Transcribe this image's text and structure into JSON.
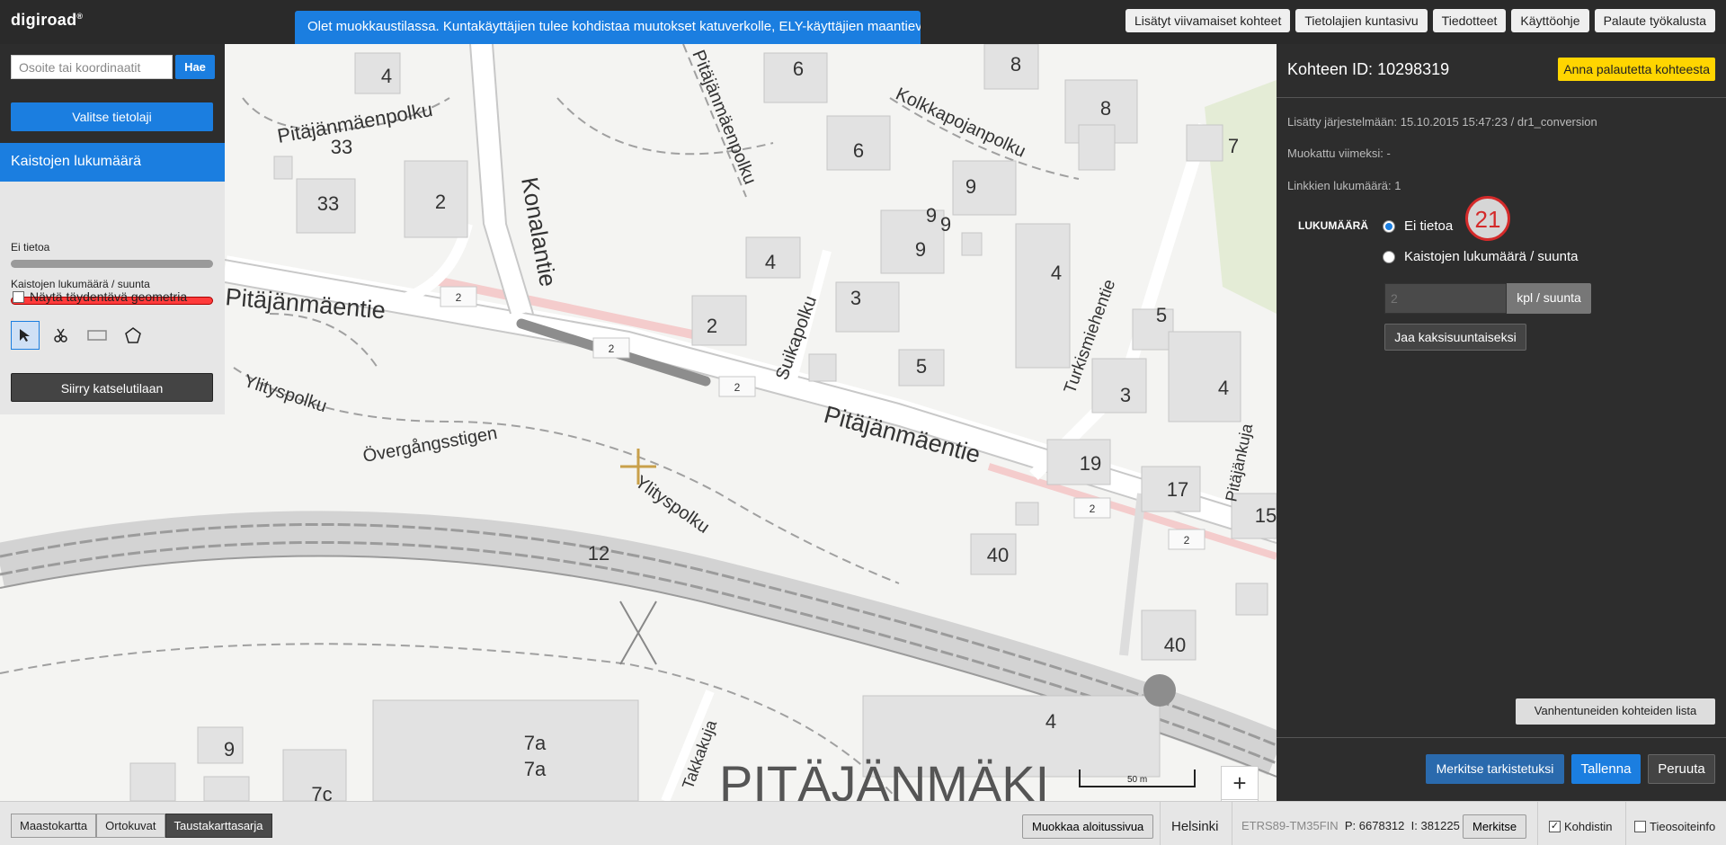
{
  "header": {
    "logo": "digiroad",
    "logo_mark": "®",
    "banner": "Olet muokkaustilassa. Kuntakäyttäjien tulee kohdistaa muutokset katuverkolle, ELY-käyttäjien maantieverkolle.",
    "links": [
      "Lisätyt viivamaiset kohteet",
      "Tietolajien kuntasivu",
      "Tiedotteet",
      "Käyttöohje",
      "Palaute työkalusta"
    ]
  },
  "left_panel": {
    "search_placeholder": "Osoite tai koordinaatit",
    "search_button": "Hae",
    "select_layer_button": "Valitse tietolaji",
    "layer_title": "Kaistojen lukumäärä",
    "legend": [
      {
        "label": "Ei tietoa",
        "color": "#9a9a9a"
      },
      {
        "label": "Kaistojen lukumäärä / suunta",
        "color": "#ff3b3b"
      }
    ],
    "complementary_geometry_label": "Näytä täydentävä geometria",
    "tools": [
      "select-arrow-icon",
      "scissors-icon",
      "rectangle-icon",
      "polygon-icon"
    ],
    "view_mode_button": "Siirry katselutilaan"
  },
  "right_panel": {
    "title": "Kohteen ID: 10298319",
    "feedback_button": "Anna palautetta kohteesta",
    "added": "Lisätty järjestelmään: 15.10.2015 15:47:23 / dr1_conversion",
    "modified": "Muokattu viimeksi: -",
    "link_count": "Linkkien lukumäärä: 1",
    "field_label": "LUKUMÄÄRÄ",
    "options": [
      "Ei tietoa",
      "Kaistojen lukumäärä / suunta"
    ],
    "selected_option": "Ei tietoa",
    "badge": "21",
    "count_placeholder": "2",
    "unit_label": "kpl / suunta",
    "split_button": "Jaa kaksisuuntaiseksi",
    "expired_button": "Vanhentuneiden kohteiden lista",
    "mark_checked_button": "Merkitse tarkistetuksi",
    "save_button": "Tallenna",
    "cancel_button": "Peruuta"
  },
  "map": {
    "zoom_in": "+",
    "zoom_out": "−",
    "scale_label": "50 m",
    "labels": {
      "pitajanmaenpolku": "Pitäjänmäenpolku",
      "pitajanmaentie": "Pitäjänmäentie",
      "konalantie": "Konalantie",
      "kolkkapojanpolku": "Kolkkapojanpolku",
      "suikapolku": "Suikapolku",
      "turkismiehentie": "Turkismiehentie",
      "ylityspolku": "Ylityspolku",
      "overgangsstigen": "Övergångsstigen",
      "pitajankuja": "Pitäjänkuja",
      "takkakuja": "Takkakuja",
      "district": "PITÄJÄNMÄKI"
    },
    "numbers": [
      "4",
      "33",
      "33",
      "2",
      "6",
      "8",
      "8",
      "6",
      "7",
      "9",
      "9",
      "9",
      "9",
      "4",
      "4",
      "3",
      "2",
      "5",
      "5",
      "3",
      "4",
      "19",
      "17",
      "15",
      "40",
      "40",
      "12",
      "4",
      "9",
      "7a",
      "7a",
      "7c"
    ],
    "road_number": "2"
  },
  "bottom_bar": {
    "basemaps": [
      "Maastokartta",
      "Ortokuvat",
      "Taustakarttasarja"
    ],
    "active_basemap": "Taustakarttasarja",
    "edit_start_button": "Muokkaa aloitussivua",
    "city": "Helsinki",
    "coord_system": "ETRS89-TM35FIN",
    "p_coord": "P: 6678312",
    "i_coord": "I: 381225",
    "mark_button": "Merkitse",
    "center_label": "Kohdistin",
    "center_checked": true,
    "address_label": "Tieosoiteinfo",
    "address_checked": false
  }
}
